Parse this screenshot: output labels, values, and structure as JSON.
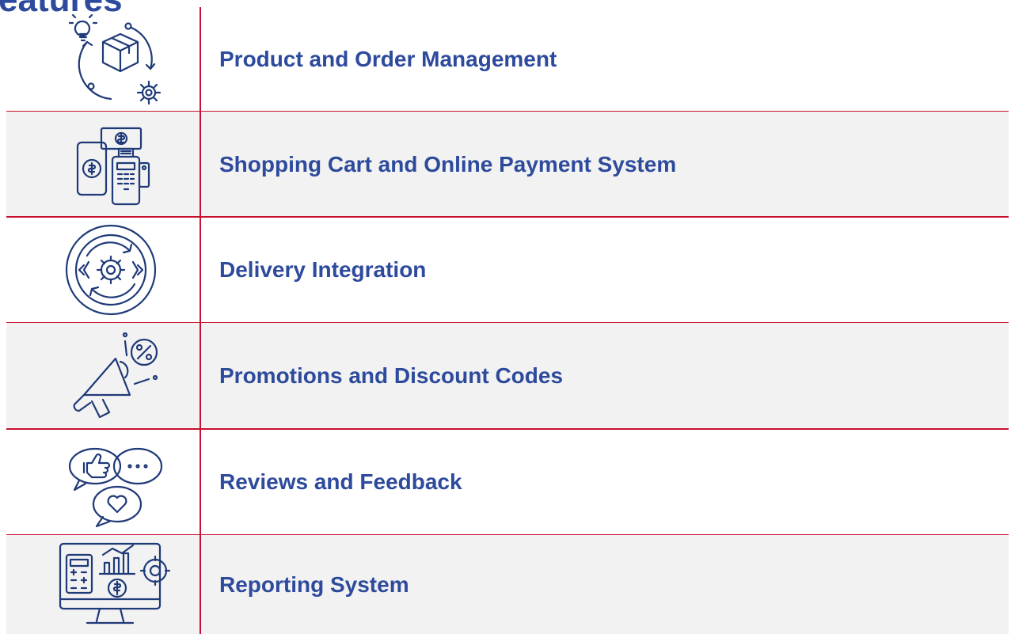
{
  "heading": "eatures",
  "colors": {
    "accent": "#2d4a9c",
    "divider": "#c8102e",
    "row_shade": "#f2f2f2"
  },
  "features": [
    {
      "label": "Product and Order Management",
      "icon": "product-cycle-icon",
      "shaded": false
    },
    {
      "label": "Shopping Cart and Online Payment System",
      "icon": "payment-terminal-icon",
      "shaded": true
    },
    {
      "label": "Delivery Integration",
      "icon": "integration-gear-icon",
      "shaded": false
    },
    {
      "label": "Promotions and Discount Codes",
      "icon": "megaphone-discount-icon",
      "shaded": true
    },
    {
      "label": "Reviews and Feedback",
      "icon": "feedback-bubbles-icon",
      "shaded": false
    },
    {
      "label": "Reporting System",
      "icon": "reporting-monitor-icon",
      "shaded": true
    }
  ]
}
